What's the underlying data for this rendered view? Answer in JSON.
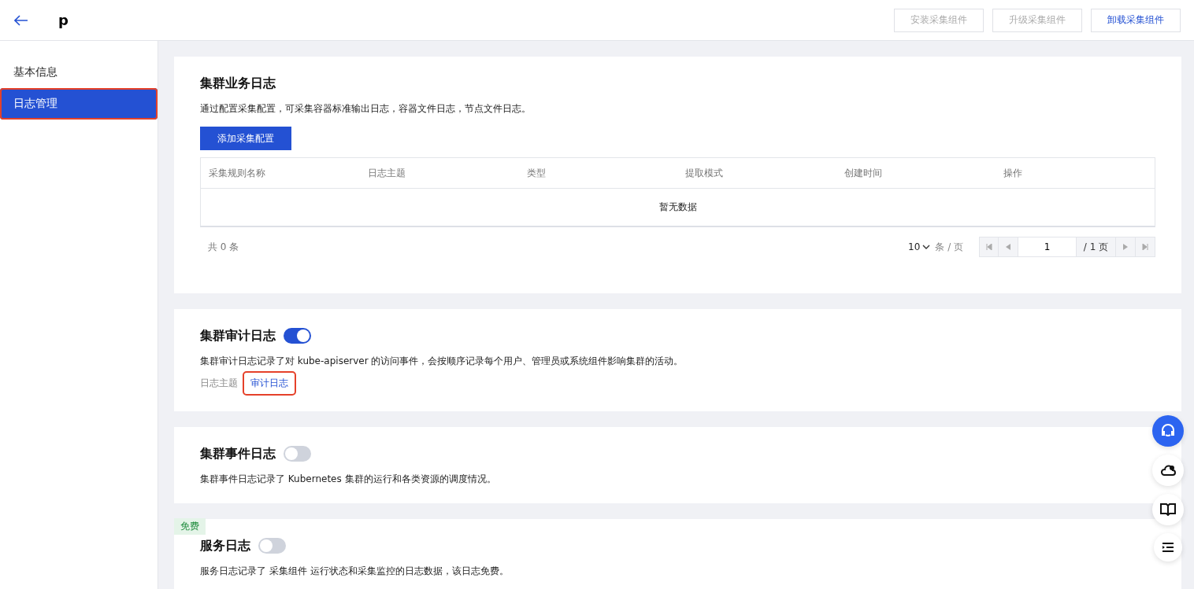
{
  "header": {
    "title": "p",
    "buttons": [
      {
        "label": "安装采集组件",
        "disabled": true
      },
      {
        "label": "升级采集组件",
        "disabled": true
      },
      {
        "label": "卸载采集组件",
        "disabled": false
      }
    ]
  },
  "sidebar": {
    "items": [
      {
        "label": "基本信息",
        "selected": false,
        "highlighted": false
      },
      {
        "label": "日志管理",
        "selected": true,
        "highlighted": true
      }
    ]
  },
  "business_log": {
    "title": "集群业务日志",
    "description": "通过配置采集配置，可采集容器标准输出日志，容器文件日志，节点文件日志。",
    "add_button": "添加采集配置",
    "table": {
      "columns": [
        "采集规则名称",
        "日志主题",
        "类型",
        "提取模式",
        "创建时间",
        "操作"
      ],
      "empty_text": "暂无数据"
    },
    "pagination": {
      "total": "共 0 条",
      "page_size": "10",
      "page_size_unit": "条 / 页",
      "page": "1",
      "page_count": "/ 1 页"
    }
  },
  "sections": [
    {
      "title": "集群审计日志",
      "on": true,
      "description": "集群审计日志记录了对 kube-apiserver 的访问事件，会按顺序记录每个用户、管理员或系统组件影响集群的活动。",
      "topic_label": "日志主题",
      "topic_link": "审计日志",
      "link_highlighted": true
    },
    {
      "title": "集群事件日志",
      "on": false,
      "description": "集群事件日志记录了 Kubernetes 集群的运行和各类资源的调度情况。"
    },
    {
      "title": "服务日志",
      "on": false,
      "badge": "免费",
      "description": "服务日志记录了 采集组件 运行状态和采集监控的日志数据，该日志免费。"
    }
  ]
}
